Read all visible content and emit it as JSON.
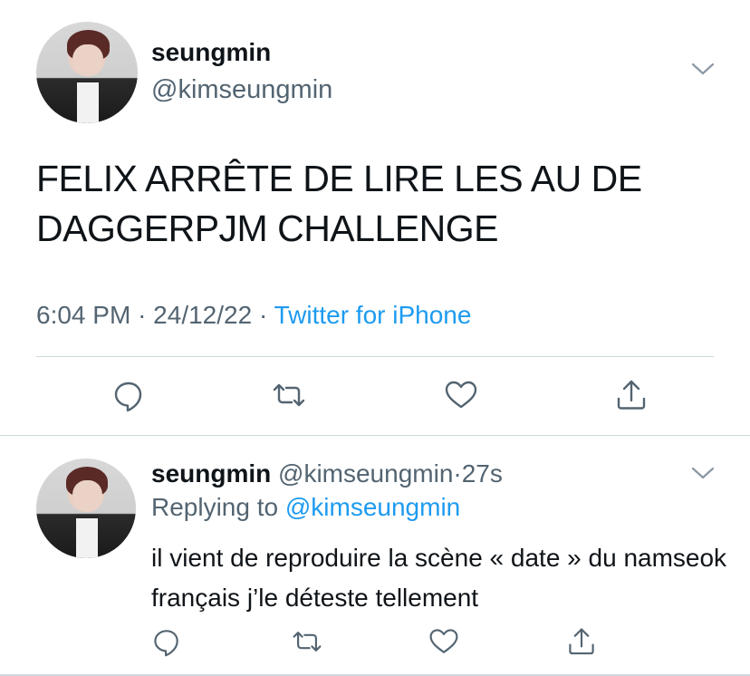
{
  "main_tweet": {
    "display_name": "seungmin",
    "handle": "@kimseungmin",
    "text": "FELIX ARRÊTE DE LIRE LES AU DE DAGGERPJM CHALLENGE",
    "time": "6:04 PM",
    "date": "24/12/22",
    "separator": "·",
    "source": "Twitter for iPhone"
  },
  "reply": {
    "display_name": "seungmin",
    "handle": "@kimseungmin",
    "separator": "·",
    "age": "27s",
    "replying_prefix": "Replying to",
    "replying_to": "@kimseungmin",
    "text": "il vient de reproduire la scène « date » du namseok français j’le déteste tellement"
  },
  "icons": {
    "reply": "reply-icon",
    "retweet": "retweet-icon",
    "like": "heart-icon",
    "share": "share-icon",
    "more": "chevron-down-icon"
  },
  "colors": {
    "text": "#0f1419",
    "secondary": "#536471",
    "link": "#1d9bf0",
    "divider": "#cfd9de"
  }
}
